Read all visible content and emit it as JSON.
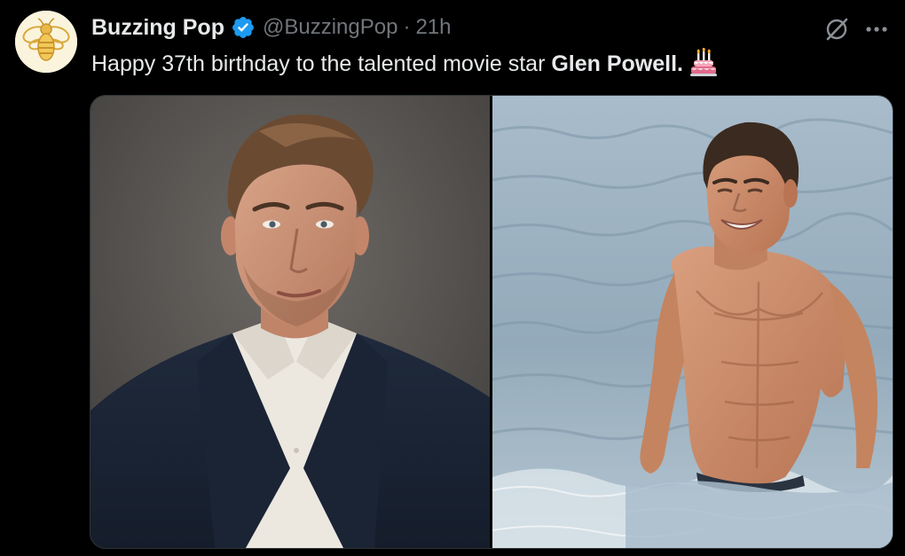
{
  "tweet": {
    "author": {
      "display_name": "Buzzing Pop",
      "handle": "@BuzzingPop",
      "verified": true,
      "avatar_icon": "bee-logo-icon"
    },
    "separator": "·",
    "time": "21h",
    "text_plain": "Happy 37th birthday to the talented movie star ",
    "text_bold": "Glen Powell.",
    "emoji": "birthday-cake-icon",
    "actions": {
      "grok_icon": "grok-icon",
      "more_icon": "more-options-icon"
    },
    "media": {
      "count": 2
    }
  },
  "colors": {
    "background": "#000000",
    "text_primary": "#e7e9ea",
    "text_secondary": "#71767b",
    "verified_blue": "#1d9bf0"
  }
}
